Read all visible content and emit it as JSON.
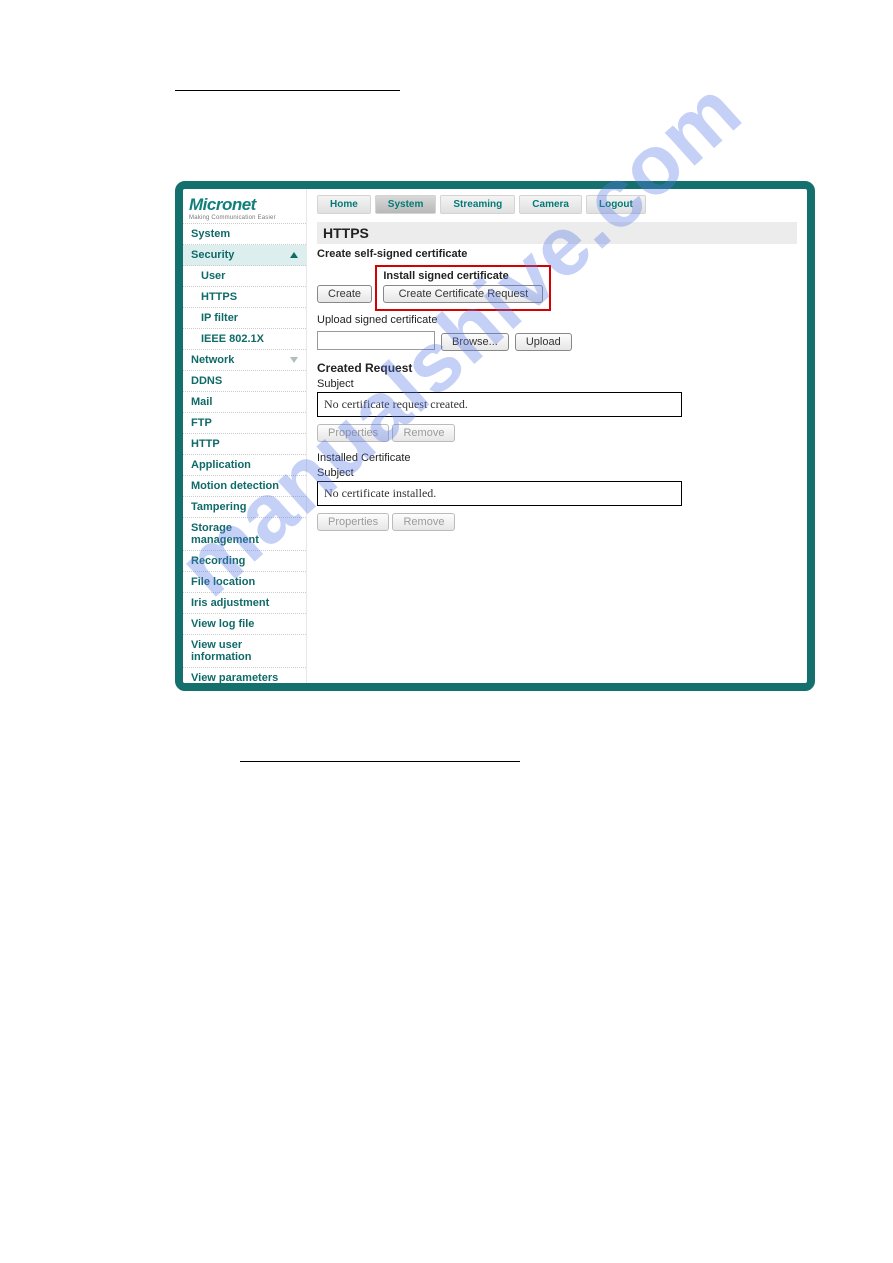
{
  "watermark": "manualshive.com",
  "logo": {
    "name": "Micronet",
    "tag": "Making Communication Easier"
  },
  "sidebar": {
    "items": [
      {
        "label": "System"
      },
      {
        "label": "Security",
        "expanded": true,
        "children": [
          {
            "label": "User"
          },
          {
            "label": "HTTPS"
          },
          {
            "label": "IP filter"
          },
          {
            "label": "IEEE 802.1X"
          }
        ]
      },
      {
        "label": "Network",
        "dropdown": true
      },
      {
        "label": "DDNS"
      },
      {
        "label": "Mail"
      },
      {
        "label": "FTP"
      },
      {
        "label": "HTTP"
      },
      {
        "label": "Application"
      },
      {
        "label": "Motion detection"
      },
      {
        "label": "Tampering"
      },
      {
        "label": "Storage management"
      },
      {
        "label": "Recording"
      },
      {
        "label": "File location"
      },
      {
        "label": "Iris adjustment"
      },
      {
        "label": "View log file"
      },
      {
        "label": "View user information"
      },
      {
        "label": "View parameters"
      }
    ]
  },
  "topnav": [
    "Home",
    "System",
    "Streaming",
    "Camera",
    "Logout"
  ],
  "page": {
    "title": "HTTPS",
    "self_signed": {
      "heading": "Create self-signed certificate",
      "create_btn": "Create"
    },
    "install": {
      "heading": "Install signed certificate",
      "cert_request_btn": "Create Certificate Request",
      "upload_heading": "Upload signed certificate",
      "browse_btn": "Browse...",
      "upload_btn": "Upload"
    },
    "created_request": {
      "heading": "Created Request",
      "subject_label": "Subject",
      "subject_value": "No certificate request created.",
      "properties_btn": "Properties",
      "remove_btn": "Remove"
    },
    "installed_cert": {
      "heading": "Installed Certificate",
      "subject_label": "Subject",
      "subject_value": "No certificate installed.",
      "properties_btn": "Properties",
      "remove_btn": "Remove"
    }
  }
}
